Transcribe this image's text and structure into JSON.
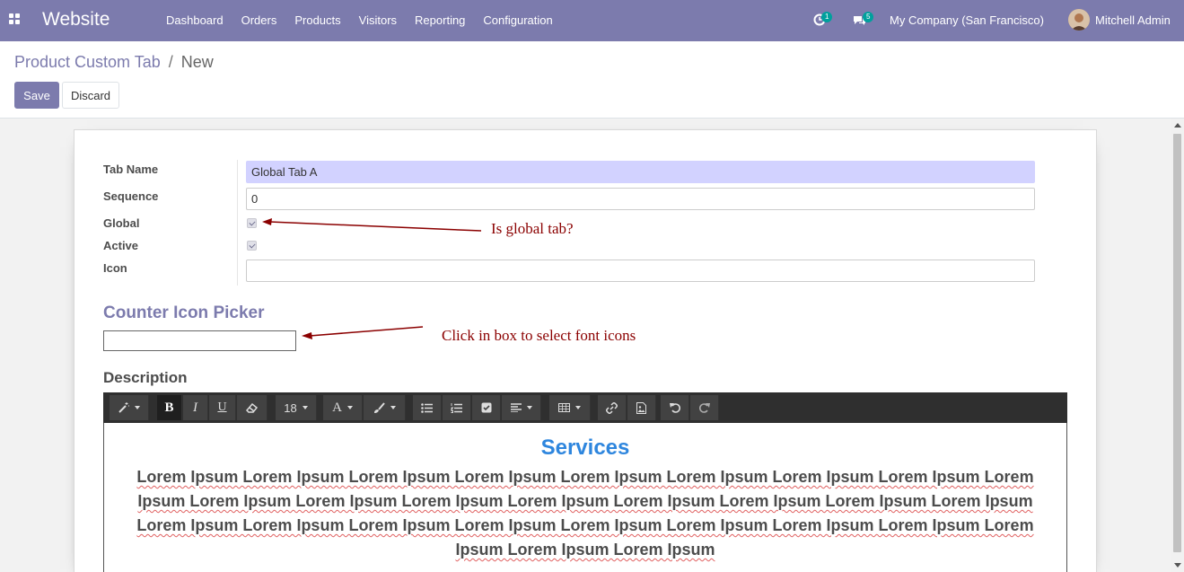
{
  "navbar": {
    "brand": "Website",
    "menu": [
      "Dashboard",
      "Orders",
      "Products",
      "Visitors",
      "Reporting",
      "Configuration"
    ],
    "activity_count": "1",
    "message_count": "5",
    "company": "My Company (San Francisco)",
    "user": "Mitchell Admin",
    "color": "#7c7bad"
  },
  "breadcrumb": {
    "parent": "Product Custom Tab",
    "separator": "/",
    "current": "New"
  },
  "buttons": {
    "save": "Save",
    "discard": "Discard"
  },
  "form": {
    "tab_name_label": "Tab Name",
    "tab_name_value": "Global Tab A",
    "sequence_label": "Sequence",
    "sequence_value": "0",
    "global_label": "Global",
    "global_checked": true,
    "active_label": "Active",
    "active_checked": true,
    "icon_label": "Icon",
    "icon_value": "",
    "counter_icon_title": "Counter Icon Picker",
    "description_title": "Description"
  },
  "annotations": {
    "global_note": "Is global tab?",
    "picker_note": "Click in box to select font icons"
  },
  "editor": {
    "font_size": "18",
    "heading": "Services",
    "body": "Lorem Ipsum Lorem Ipsum Lorem Ipsum Lorem Ipsum Lorem Ipsum Lorem Ipsum Lorem Ipsum Lorem Ipsum Lorem Ipsum Lorem Ipsum Lorem Ipsum Lorem Ipsum Lorem Ipsum Lorem Ipsum Lorem Ipsum Lorem Ipsum Lorem Ipsum Lorem Ipsum Lorem Ipsum Lorem Ipsum Lorem Ipsum Lorem Ipsum Lorem Ipsum Lorem Ipsum Lorem Ipsum Lorem Ipsum Lorem Ipsum Lorem Ipsum"
  }
}
